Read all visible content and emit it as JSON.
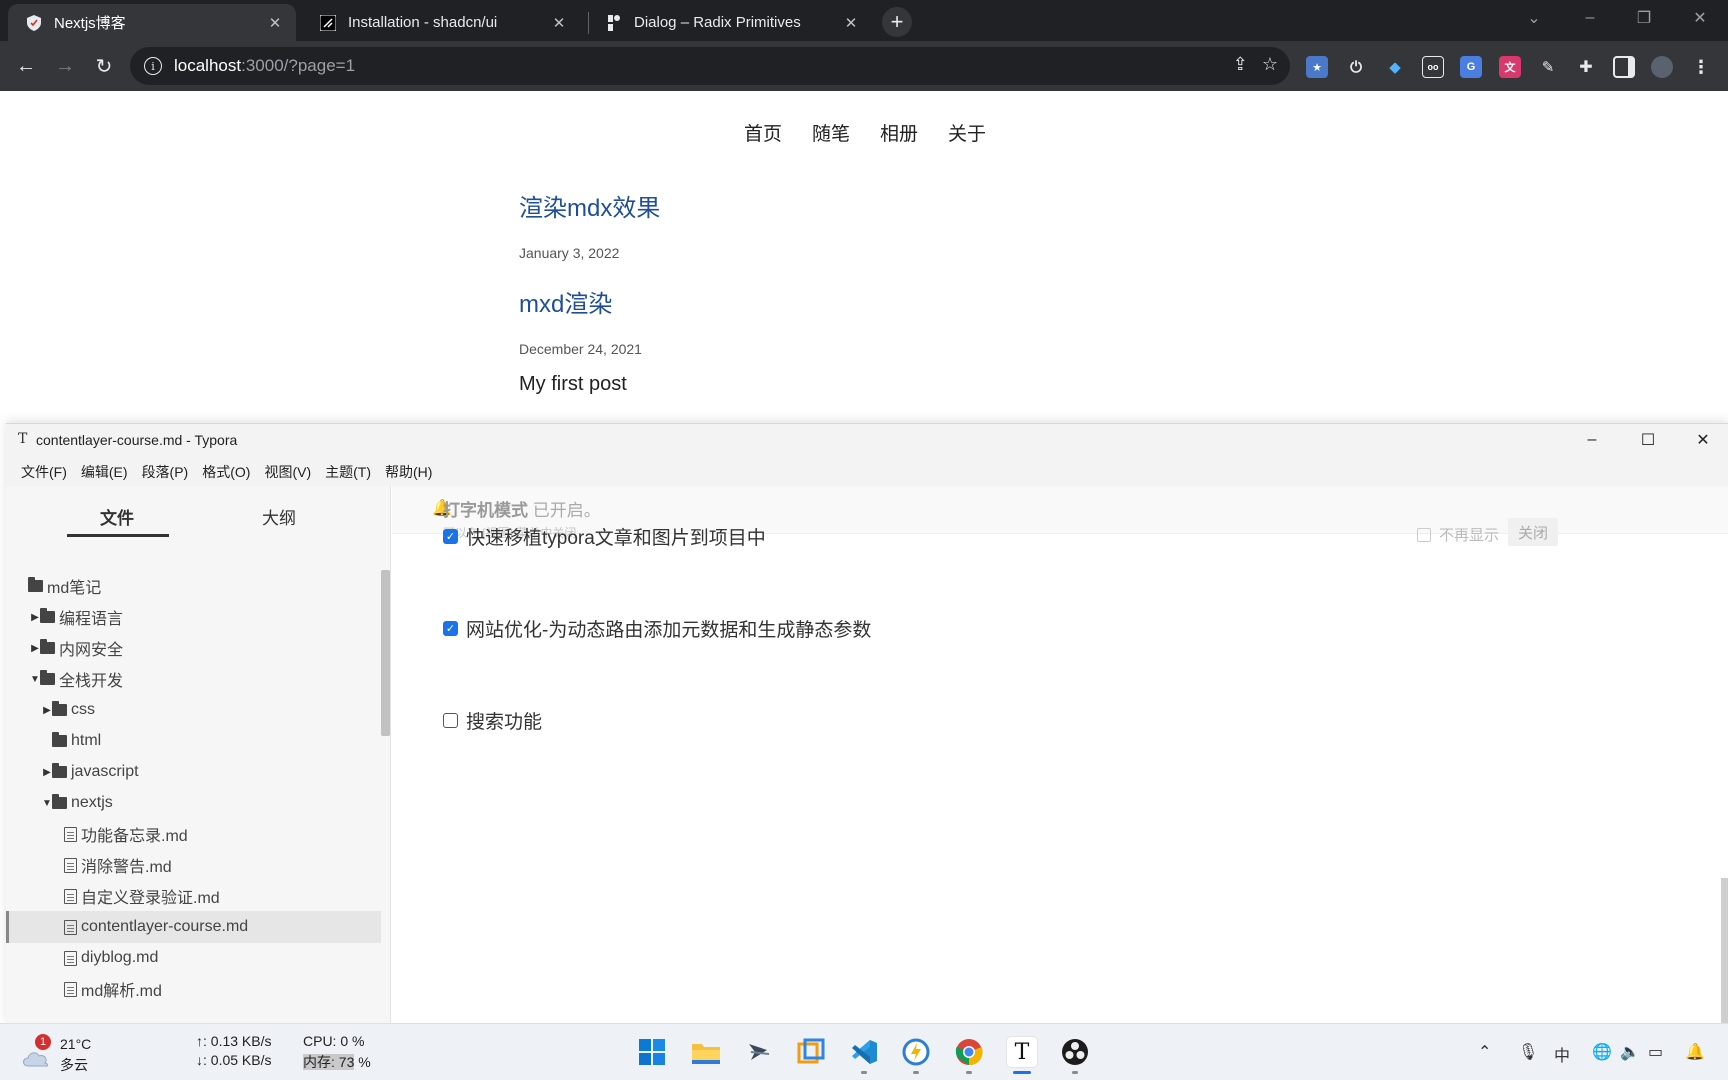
{
  "browser": {
    "tabs": [
      {
        "title": "Nextjs博客",
        "active": true
      },
      {
        "title": "Installation - shadcn/ui",
        "active": false
      },
      {
        "title": "Dialog – Radix Primitives",
        "active": false
      }
    ],
    "url_host": "localhost",
    "url_rest": ":3000/?page=1"
  },
  "site": {
    "nav": [
      "首页",
      "随笔",
      "相册",
      "关于"
    ],
    "posts": [
      {
        "title": "渲染mdx效果",
        "date": "January 3, 2022"
      },
      {
        "title": "mxd渲染",
        "date": "December 24, 2021"
      }
    ],
    "plain_post": "My first post"
  },
  "typora": {
    "logo": "T",
    "window_title": "contentlayer-course.md - Typora",
    "menu": [
      "文件(F)",
      "编辑(E)",
      "段落(P)",
      "格式(O)",
      "视图(V)",
      "主题(T)",
      "帮助(H)"
    ],
    "sidebar_tabs": [
      "文件",
      "大纲"
    ],
    "tree": [
      {
        "label": "md笔记",
        "type": "folder",
        "caret": "",
        "indent": 0
      },
      {
        "label": "编程语言",
        "type": "folder",
        "caret": "▶",
        "indent": 1
      },
      {
        "label": "内网安全",
        "type": "folder",
        "caret": "▶",
        "indent": 1
      },
      {
        "label": "全栈开发",
        "type": "folder",
        "caret": "▼",
        "indent": 1
      },
      {
        "label": "css",
        "type": "folder",
        "caret": "▶",
        "indent": 2
      },
      {
        "label": "html",
        "type": "folder",
        "caret": "",
        "indent": 2
      },
      {
        "label": "javascript",
        "type": "folder",
        "caret": "▶",
        "indent": 2
      },
      {
        "label": "nextjs",
        "type": "folder",
        "caret": "▼",
        "indent": 2
      },
      {
        "label": "功能备忘录.md",
        "type": "file",
        "caret": "",
        "indent": 3
      },
      {
        "label": "消除警告.md",
        "type": "file",
        "caret": "",
        "indent": 3
      },
      {
        "label": "自定义登录验证.md",
        "type": "file",
        "caret": "",
        "indent": 3
      },
      {
        "label": "contentlayer-course.md",
        "type": "file",
        "caret": "",
        "indent": 3,
        "selected": true
      },
      {
        "label": "diyblog.md",
        "type": "file",
        "caret": "",
        "indent": 3
      },
      {
        "label": "md解析.md",
        "type": "file",
        "caret": "",
        "indent": 3
      }
    ],
    "notice": {
      "bold": "打字机模式",
      "text": "已开启。",
      "sub": "可以在 [视图] 菜单中关闭",
      "dont_show": "不再显示",
      "close": "关闭"
    },
    "tasks": [
      {
        "label": "快速移植typora文章和图片到项目中",
        "checked": true
      },
      {
        "label": "网站优化-为动态路由添加元数据和生成静态参数",
        "checked": true
      },
      {
        "label": "搜索功能",
        "checked": false
      }
    ]
  },
  "taskbar": {
    "weather_badge": "1",
    "temperature": "21°C",
    "condition": "多云",
    "net_up": "↑: 0.13 KB/s",
    "net_down": "↓: 0.05 KB/s",
    "cpu": "CPU: 0 %",
    "mem_label": "内存: 73",
    "mem_unit": " %",
    "ime": "中"
  },
  "colors": {
    "chrome_dark": "#202124",
    "link_blue": "#1f4e9c",
    "checkbox_blue": "#1a73e8"
  }
}
